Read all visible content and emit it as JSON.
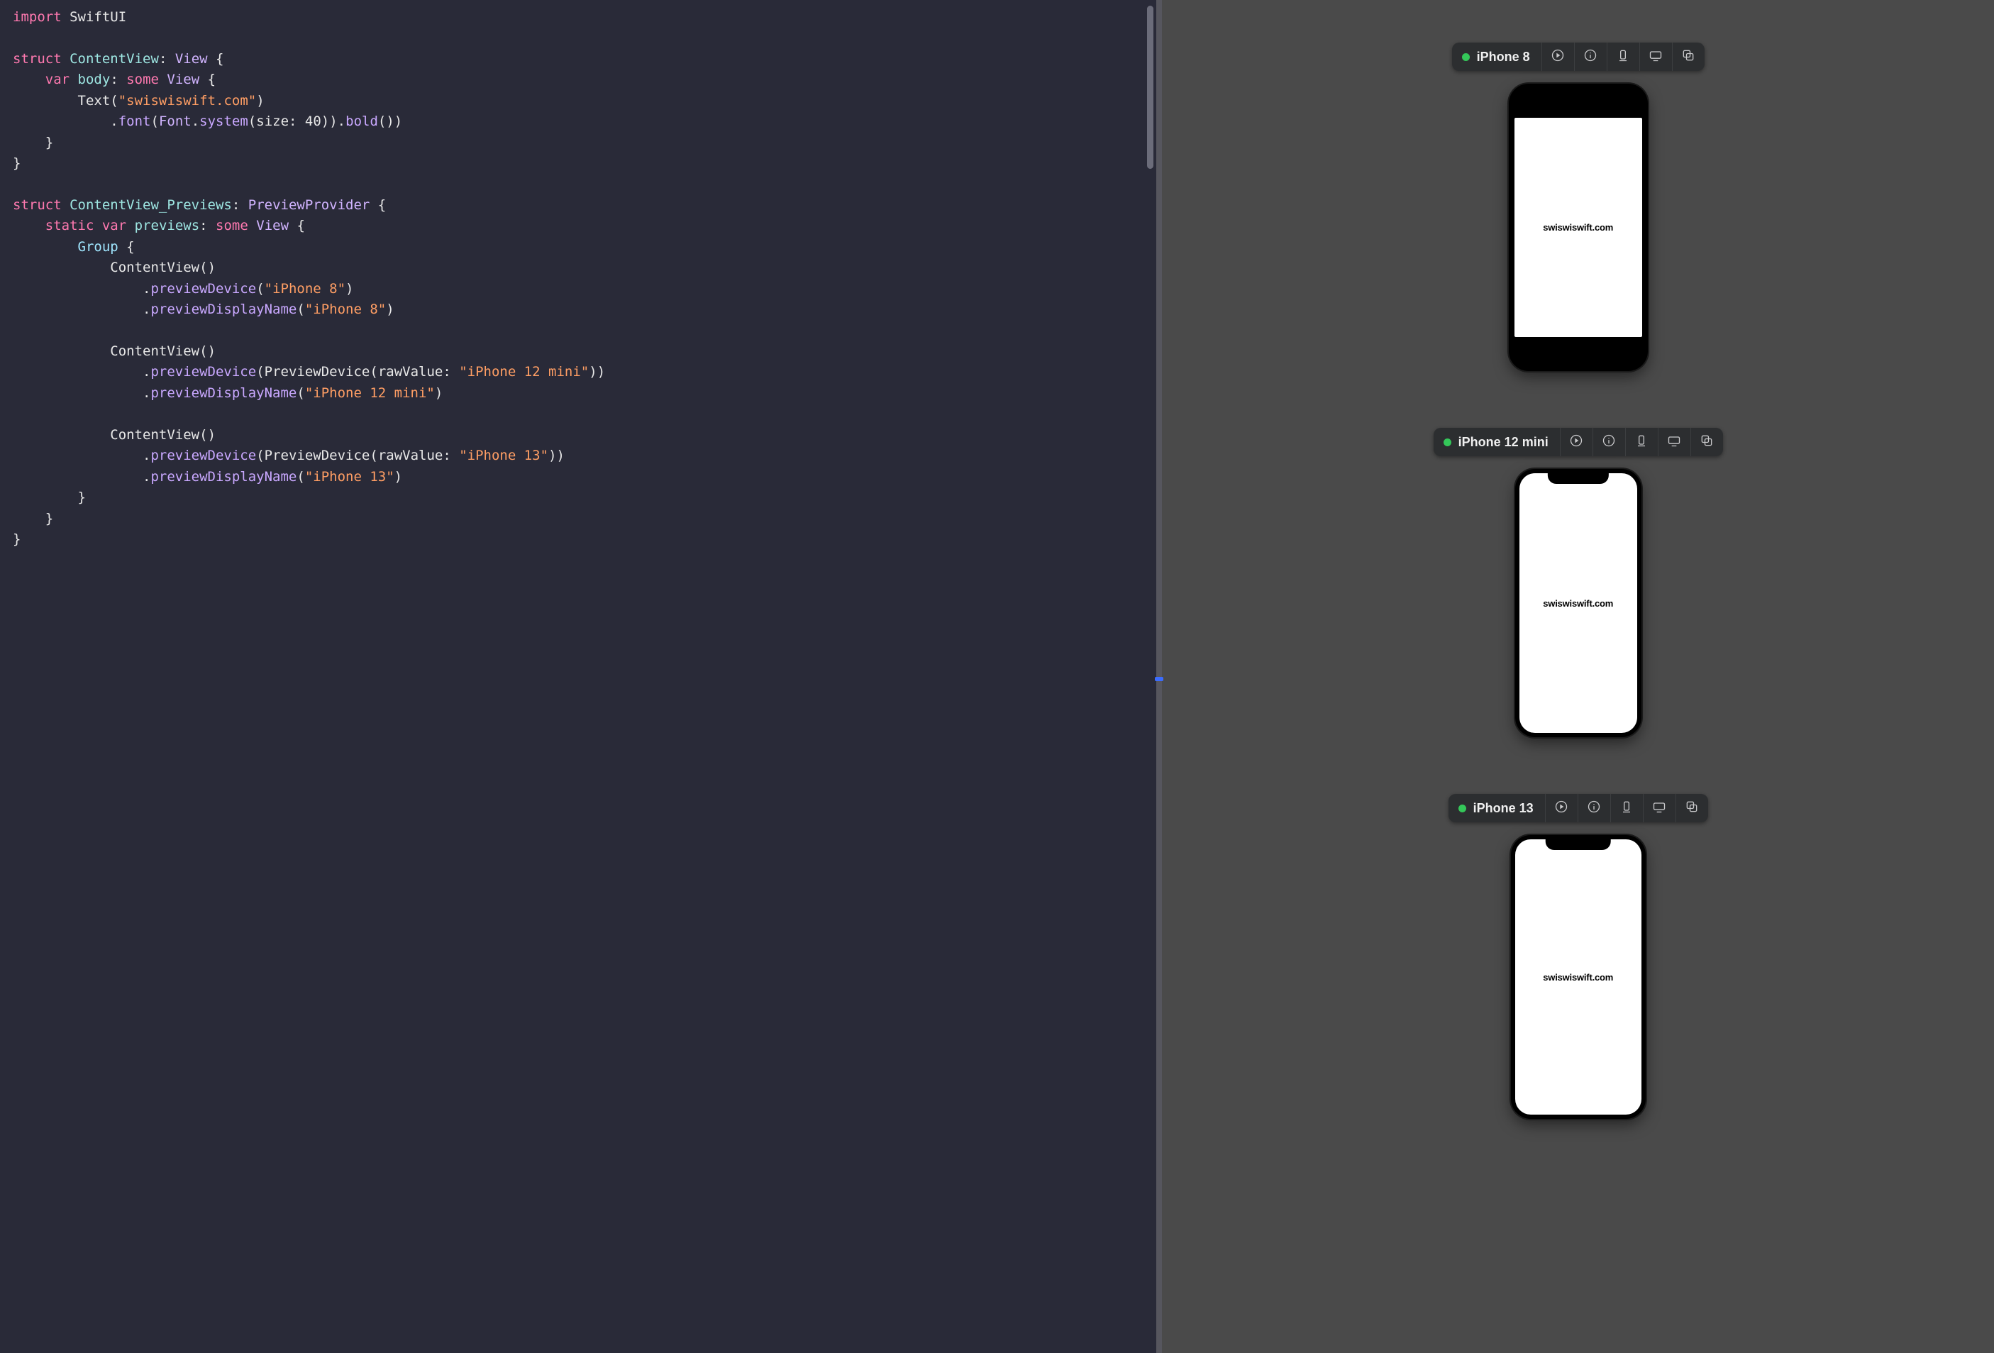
{
  "app_content_text": "swiswiswift.com",
  "code": {
    "lines": [
      [
        [
          "kw",
          "import"
        ],
        [
          "plain",
          " "
        ],
        [
          "plain",
          "SwiftUI"
        ]
      ],
      [],
      [
        [
          "kw",
          "struct"
        ],
        [
          "plain",
          " "
        ],
        [
          "type",
          "ContentView"
        ],
        [
          "plain",
          ": "
        ],
        [
          "type2",
          "View"
        ],
        [
          "plain",
          " {"
        ]
      ],
      [
        [
          "plain",
          "    "
        ],
        [
          "kw",
          "var"
        ],
        [
          "plain",
          " "
        ],
        [
          "type",
          "body"
        ],
        [
          "plain",
          ": "
        ],
        [
          "kw",
          "some"
        ],
        [
          "plain",
          " "
        ],
        [
          "type2",
          "View"
        ],
        [
          "plain",
          " {"
        ]
      ],
      [
        [
          "plain",
          "        "
        ],
        [
          "plain",
          "Text"
        ],
        [
          "plain",
          "("
        ],
        [
          "str",
          "\"swiswiswift.com\""
        ],
        [
          "plain",
          ")"
        ]
      ],
      [
        [
          "plain",
          "            ."
        ],
        [
          "method",
          "font"
        ],
        [
          "plain",
          "("
        ],
        [
          "type2",
          "Font"
        ],
        [
          "plain",
          "."
        ],
        [
          "method",
          "system"
        ],
        [
          "plain",
          "("
        ],
        [
          "plain",
          "size"
        ],
        [
          "plain",
          ": "
        ],
        [
          "plain",
          "40"
        ],
        [
          "plain",
          "))."
        ],
        [
          "method",
          "bold"
        ],
        [
          "plain",
          "())"
        ]
      ],
      [
        [
          "plain",
          "    }"
        ]
      ],
      [
        [
          "plain",
          "}"
        ]
      ],
      [],
      [
        [
          "kw",
          "struct"
        ],
        [
          "plain",
          " "
        ],
        [
          "type",
          "ContentView_Previews"
        ],
        [
          "plain",
          ": "
        ],
        [
          "type2",
          "PreviewProvider"
        ],
        [
          "plain",
          " {"
        ]
      ],
      [
        [
          "plain",
          "    "
        ],
        [
          "kw",
          "static"
        ],
        [
          "plain",
          " "
        ],
        [
          "kw",
          "var"
        ],
        [
          "plain",
          " "
        ],
        [
          "type",
          "previews"
        ],
        [
          "plain",
          ": "
        ],
        [
          "kw",
          "some"
        ],
        [
          "plain",
          " "
        ],
        [
          "type2",
          "View"
        ],
        [
          "plain",
          " {"
        ]
      ],
      [
        [
          "plain",
          "        "
        ],
        [
          "builtin",
          "Group"
        ],
        [
          "plain",
          " {"
        ]
      ],
      [
        [
          "plain",
          "            "
        ],
        [
          "plain",
          "ContentView"
        ],
        [
          "plain",
          "()"
        ]
      ],
      [
        [
          "plain",
          "                ."
        ],
        [
          "method",
          "previewDevice"
        ],
        [
          "plain",
          "("
        ],
        [
          "str",
          "\"iPhone 8\""
        ],
        [
          "plain",
          ")"
        ]
      ],
      [
        [
          "plain",
          "                ."
        ],
        [
          "method",
          "previewDisplayName"
        ],
        [
          "plain",
          "("
        ],
        [
          "str",
          "\"iPhone 8\""
        ],
        [
          "plain",
          ")"
        ]
      ],
      [],
      [
        [
          "plain",
          "            "
        ],
        [
          "plain",
          "ContentView"
        ],
        [
          "plain",
          "()"
        ]
      ],
      [
        [
          "plain",
          "                ."
        ],
        [
          "method",
          "previewDevice"
        ],
        [
          "plain",
          "("
        ],
        [
          "plain",
          "PreviewDevice"
        ],
        [
          "plain",
          "("
        ],
        [
          "plain",
          "rawValue"
        ],
        [
          "plain",
          ": "
        ],
        [
          "str",
          "\"iPhone 12 mini\""
        ],
        [
          "plain",
          "))"
        ]
      ],
      [
        [
          "plain",
          "                ."
        ],
        [
          "method",
          "previewDisplayName"
        ],
        [
          "plain",
          "("
        ],
        [
          "str",
          "\"iPhone 12 mini\""
        ],
        [
          "plain",
          ")"
        ]
      ],
      [],
      [
        [
          "plain",
          "            "
        ],
        [
          "plain",
          "ContentView"
        ],
        [
          "plain",
          "()"
        ]
      ],
      [
        [
          "plain",
          "                ."
        ],
        [
          "method",
          "previewDevice"
        ],
        [
          "plain",
          "("
        ],
        [
          "plain",
          "PreviewDevice"
        ],
        [
          "plain",
          "("
        ],
        [
          "plain",
          "rawValue"
        ],
        [
          "plain",
          ": "
        ],
        [
          "str",
          "\"iPhone 13\""
        ],
        [
          "plain",
          "))"
        ]
      ],
      [
        [
          "plain",
          "                ."
        ],
        [
          "method",
          "previewDisplayName"
        ],
        [
          "plain",
          "("
        ],
        [
          "str",
          "\"iPhone 13\""
        ],
        [
          "plain",
          ")"
        ]
      ],
      [
        [
          "plain",
          "        }"
        ]
      ],
      [
        [
          "plain",
          "    }"
        ]
      ],
      [
        [
          "plain",
          "}"
        ]
      ]
    ]
  },
  "previews": [
    {
      "name": "iPhone 8",
      "device_class": "iphone8"
    },
    {
      "name": "iPhone 12 mini",
      "device_class": "iphoneX mini"
    },
    {
      "name": "iPhone 13",
      "device_class": "iphoneX reg"
    }
  ],
  "toolbar_icons": [
    "live-preview-icon",
    "inspect-icon",
    "device-settings-icon",
    "preview-on-device-icon",
    "duplicate-preview-icon"
  ]
}
